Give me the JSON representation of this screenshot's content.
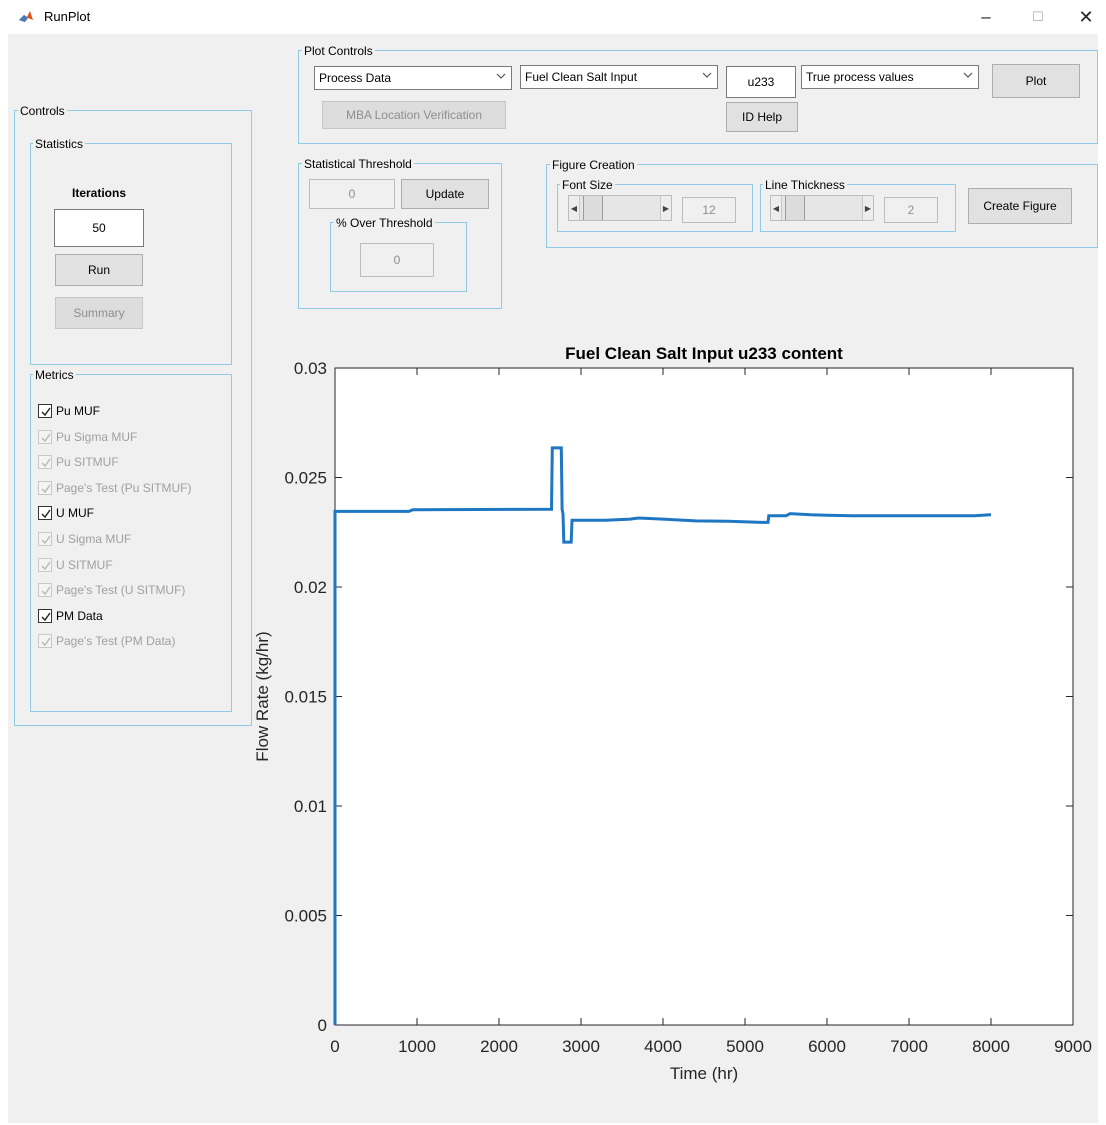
{
  "window": {
    "title": "RunPlot"
  },
  "plot_controls": {
    "label": "Plot Controls",
    "data_source": "Process Data",
    "stream": "Fuel Clean Salt Input",
    "isotope": "u233",
    "value_type": "True process values",
    "plot_button": "Plot",
    "mba_button": "MBA Location Verification",
    "id_help_button": "ID Help"
  },
  "controls": {
    "label": "Controls",
    "statistics": {
      "label": "Statistics",
      "iterations_label": "Iterations",
      "iterations_value": "50",
      "run_button": "Run",
      "summary_button": "Summary"
    },
    "metrics": {
      "label": "Metrics",
      "items": [
        {
          "label": "Pu MUF",
          "checked": true,
          "enabled": true
        },
        {
          "label": "Pu Sigma MUF",
          "checked": true,
          "enabled": false
        },
        {
          "label": "Pu SITMUF",
          "checked": true,
          "enabled": false
        },
        {
          "label": "Page's Test (Pu SITMUF)",
          "checked": true,
          "enabled": false
        },
        {
          "label": "U MUF",
          "checked": true,
          "enabled": true
        },
        {
          "label": "U Sigma MUF",
          "checked": true,
          "enabled": false
        },
        {
          "label": "U SITMUF",
          "checked": true,
          "enabled": false
        },
        {
          "label": "Page's Test (U SITMUF)",
          "checked": true,
          "enabled": false
        },
        {
          "label": "PM Data",
          "checked": true,
          "enabled": true
        },
        {
          "label": "Page's Test (PM Data)",
          "checked": true,
          "enabled": false
        }
      ]
    }
  },
  "statistical_threshold": {
    "label": "Statistical Threshold",
    "value": "0",
    "update_button": "Update",
    "over_label": "% Over Threshold",
    "over_value": "0"
  },
  "figure_creation": {
    "label": "Figure Creation",
    "font_size_label": "Font Size",
    "font_size_value": "12",
    "line_thickness_label": "Line Thickness",
    "line_thickness_value": "2",
    "create_button": "Create Figure"
  },
  "chart_data": {
    "type": "line",
    "title": "Fuel Clean Salt Input  u233 content",
    "xlabel": "Time (hr)",
    "ylabel": "Flow Rate (kg/hr)",
    "xlim": [
      0,
      9000
    ],
    "ylim": [
      0,
      0.03
    ],
    "xticks": [
      "0",
      "1000",
      "2000",
      "3000",
      "4000",
      "5000",
      "6000",
      "7000",
      "8000",
      "9000"
    ],
    "yticks": [
      "0",
      "0.005",
      "0.01",
      "0.015",
      "0.02",
      "0.025",
      "0.03"
    ],
    "line_color": "#1f77c4",
    "series": [
      {
        "x": [
          0,
          0,
          900,
          950,
          2640,
          2650,
          2760,
          2770,
          2780,
          2790,
          2880,
          2890,
          3300,
          3600,
          3700,
          4000,
          4400,
          4800,
          5200,
          5280,
          5290,
          5500,
          5550,
          5800,
          6000,
          6300,
          7000,
          7500,
          7800,
          7990,
          8000
        ],
        "y": [
          0,
          0.02345,
          0.02345,
          0.02353,
          0.02355,
          0.02635,
          0.02635,
          0.02355,
          0.02335,
          0.02205,
          0.02205,
          0.02305,
          0.02305,
          0.0231,
          0.02315,
          0.0231,
          0.02302,
          0.023,
          0.02295,
          0.02295,
          0.02325,
          0.02325,
          0.02335,
          0.0233,
          0.02328,
          0.02325,
          0.02325,
          0.02325,
          0.02325,
          0.0233,
          0.0233
        ]
      }
    ]
  }
}
